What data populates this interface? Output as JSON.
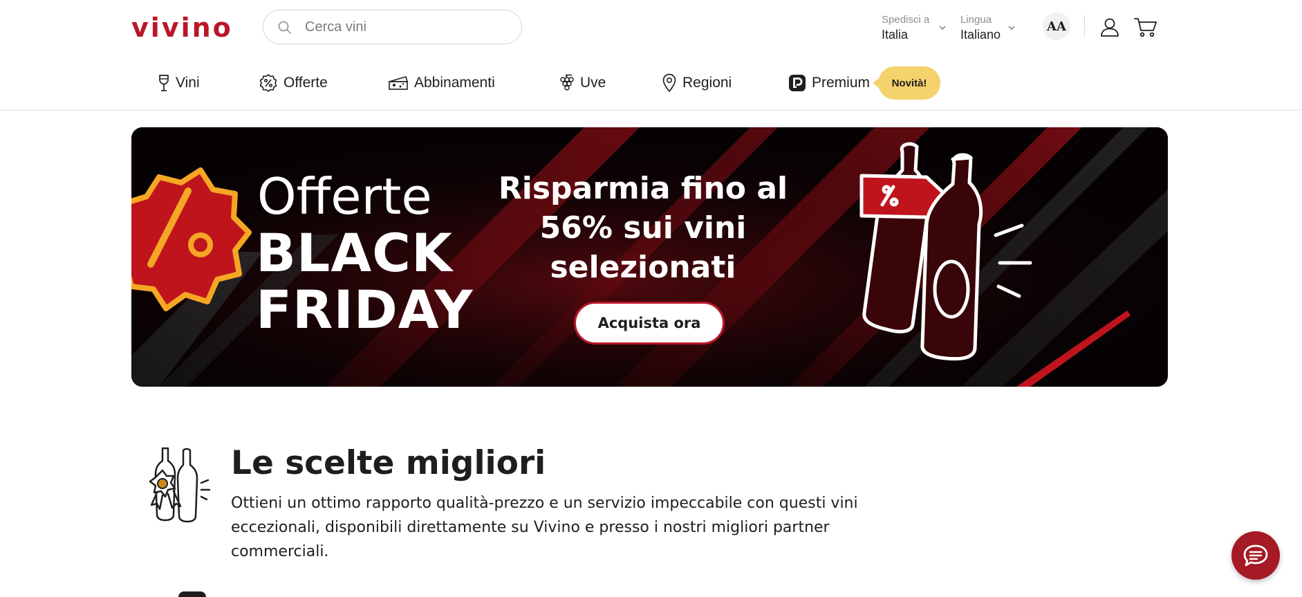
{
  "header": {
    "logo_text": "vivino",
    "search": {
      "placeholder": "Cerca vini",
      "icon": "search-icon"
    },
    "ship_to": {
      "label": "Spedisci a",
      "value": "Italia"
    },
    "language": {
      "label": "Lingua",
      "value": "Italiano"
    },
    "text_size_label": "AA",
    "icons": [
      "text-size-icon",
      "user-icon",
      "cart-icon"
    ]
  },
  "nav": {
    "items": [
      {
        "label": "Vini",
        "icon": "wine-glass-icon"
      },
      {
        "label": "Offerte",
        "icon": "discount-icon"
      },
      {
        "label": "Abbinamenti",
        "icon": "food-pairing-icon"
      },
      {
        "label": "Uve",
        "icon": "grapes-icon"
      },
      {
        "label": "Regioni",
        "icon": "location-pin-icon"
      },
      {
        "label": "Premium",
        "icon": "premium-icon"
      }
    ],
    "new_badge": "Novità!"
  },
  "banner": {
    "title_line1": "Offerte",
    "title_line2": "BLACK",
    "title_line3": "FRIDAY",
    "subtitle": "Risparmia fino al 56% sui vini selezionati",
    "cta": "Acquista ora",
    "colors": {
      "accent": "#ba1628",
      "orange": "#f5a623",
      "background": "#060203"
    }
  },
  "section": {
    "title": "Le scelte migliori",
    "description": "Ottieni un ottimo rapporto qualità-prezzo e un servizio impeccabile con questi vini eccezionali, disponibili direttamente su Vivino e presso i nostri migliori partner commerciali."
  },
  "chat": {
    "icon": "chat-icon"
  },
  "colors": {
    "brand": "#ba1628",
    "badge": "#f5d36c",
    "chat": "#a51a24"
  }
}
